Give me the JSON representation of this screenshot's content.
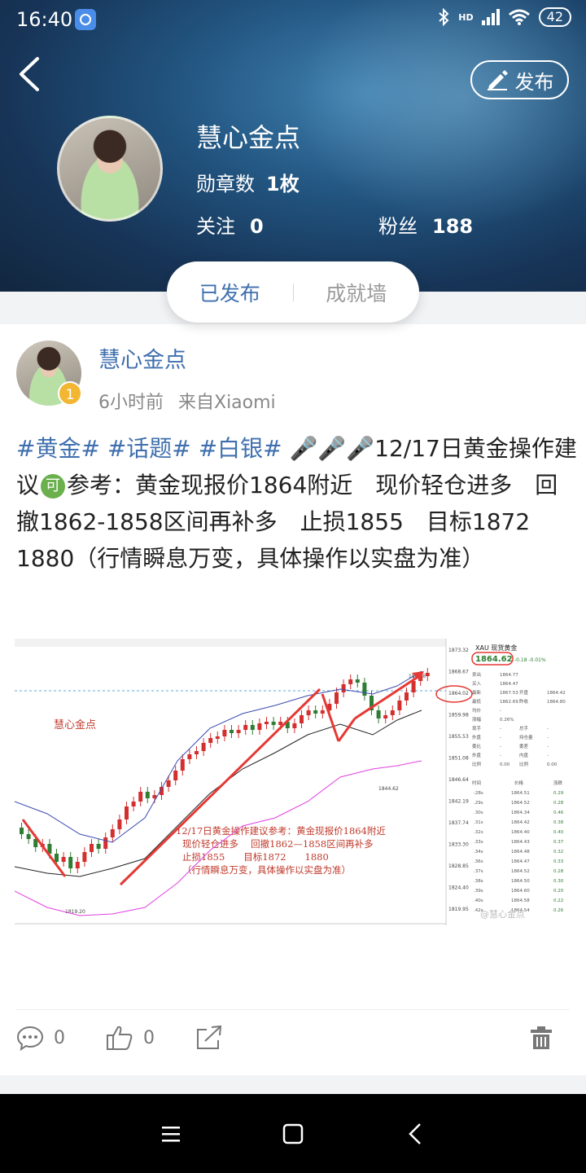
{
  "status_bar": {
    "time": "16:40",
    "battery": "42",
    "network": "HD"
  },
  "header": {
    "publish_label": "发布",
    "user_name": "慧心金点",
    "medals_label": "勋章数",
    "medals_value": "1枚",
    "following_label": "关注",
    "following_value": "0",
    "fans_label": "粉丝",
    "fans_value": "188"
  },
  "tabs": {
    "published": "已发布",
    "achievements": "成就墙"
  },
  "post": {
    "author": "慧心金点",
    "level": "1",
    "time_ago": "6小时前",
    "source": "来自Xiaomi",
    "tags": [
      "#黄金#",
      "#话题#",
      "#白银#"
    ],
    "mic_icons": "🎤🎤🎤",
    "text_head": "12/17日黄金操作建议",
    "ke_icon": "可",
    "text_body": "参考：黄金现报价1864附近　现价轻仓进多　回撤1862-1858区间再补多　止损1855　目标1872　1880（行情瞬息万变，具体操作以实盘为准）",
    "comments": "0",
    "likes": "0"
  },
  "chart_image": {
    "watermark": "慧心金点",
    "annotation_lines": [
      "12/17日黄金操作建议参考：黄金现报价1864附近",
      "现价轻仓进多　 回撤1862—1858区间再补多",
      "止损1855　　目标1872　　1880",
      "（行情瞬息万变，具体操作以实盘为准）"
    ],
    "quote_title": "XAU 现货黄金",
    "quote_price": "1864.62",
    "quote_change": "-0.18  -0.01%",
    "y_ticks": [
      "1873.32",
      "1868.67",
      "1864.02",
      "1859.98",
      "1855.53",
      "1851.08",
      "1846.64",
      "1842.19",
      "1837.74",
      "1833.30",
      "1828.85",
      "1824.40",
      "1819.95"
    ],
    "low_label": "1819.20",
    "mid_label": "1844.62",
    "top_label": "1864.6",
    "side_rows": [
      [
        "卖出",
        "1864.77"
      ],
      [
        "买入",
        "1864.47"
      ],
      [
        "最新",
        "1867.53",
        "开盘",
        "1864.42"
      ],
      [
        "最低",
        "1862.69",
        "昨收",
        "1864.80"
      ],
      [
        "均价",
        "-"
      ],
      [
        "涨幅",
        "0.26%"
      ],
      [
        "现手",
        "-",
        "总手",
        "-"
      ],
      [
        "外盘",
        "-",
        "持仓量",
        "-"
      ],
      [
        "委比",
        "-",
        "委差",
        "-"
      ],
      [
        "外盘",
        "-",
        "内盘",
        "-"
      ],
      [
        "比例",
        "0.00",
        "比例",
        "0.00"
      ]
    ],
    "tick_header": [
      "时间",
      "价格",
      "涨跌"
    ],
    "tick_rows": [
      [
        ":28s",
        "1864.51",
        "0.29"
      ],
      [
        ".29s",
        "1864.52",
        "0.28"
      ],
      [
        ".30s",
        "1864.34",
        "0.46"
      ],
      [
        ".31s",
        "1864.42",
        "0.38"
      ],
      [
        ".32s",
        "1864.40",
        "0.40"
      ],
      [
        ".33s",
        "1864.43",
        "0.37"
      ],
      [
        ".34s",
        "1864.48",
        "0.32"
      ],
      [
        ".36s",
        "1864.47",
        "0.33"
      ],
      [
        ".37s",
        "1864.52",
        "0.28"
      ],
      [
        ".38s",
        "1864.50",
        "0.30"
      ],
      [
        ".39s",
        "1864.60",
        "0.20"
      ],
      [
        ".40s",
        "1864.58",
        "0.22"
      ],
      [
        ".42s",
        "1864.54",
        "0.26"
      ]
    ],
    "weibo_mark": "@慧心金点"
  }
}
